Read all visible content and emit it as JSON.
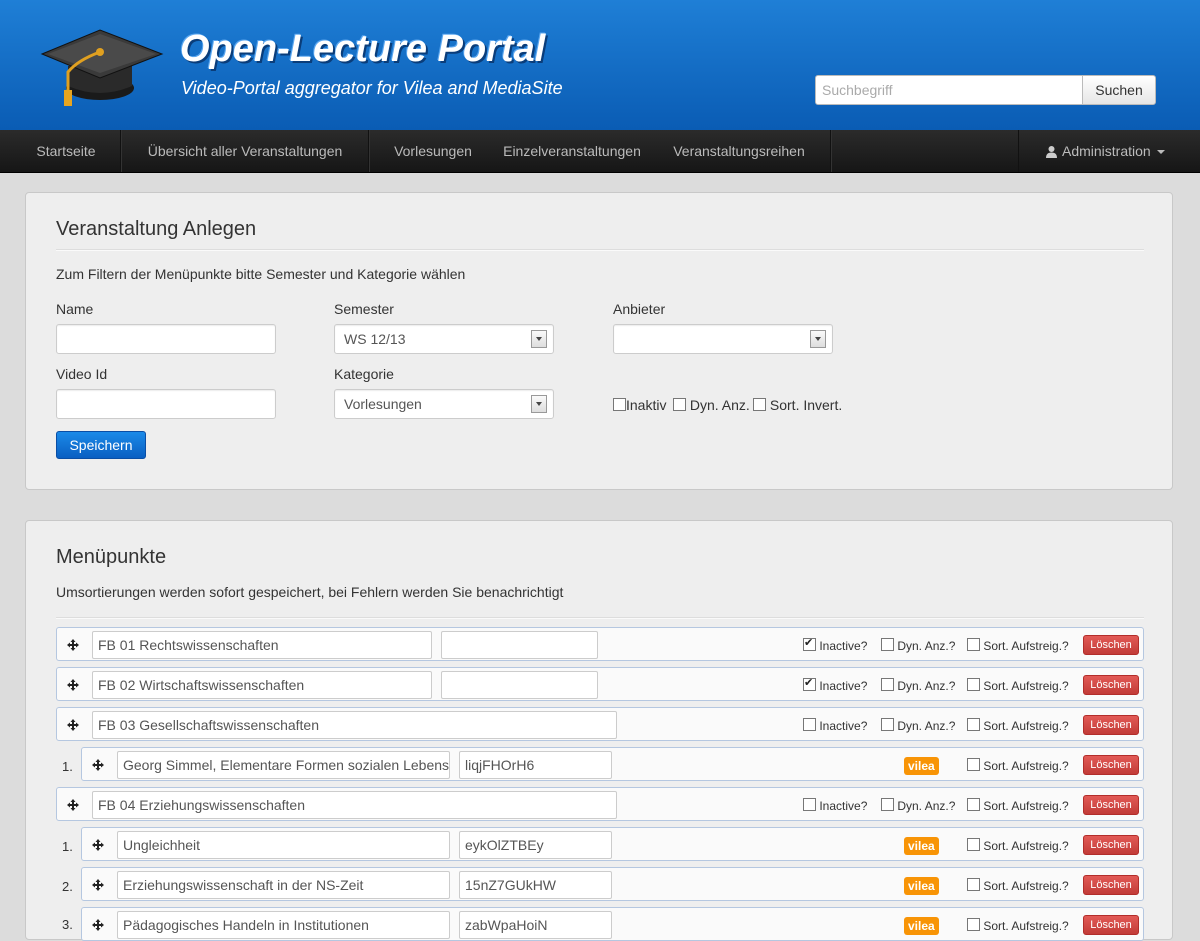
{
  "header": {
    "title": "Open-Lecture Portal",
    "subtitle": "Video-Portal aggregator for Vilea and MediaSite",
    "search_placeholder": "Suchbegriff",
    "search_button": "Suchen"
  },
  "nav": {
    "items": [
      "Startseite",
      "Übersicht aller Veranstaltungen",
      "Vorlesungen",
      "Einzelveranstaltungen",
      "Veranstaltungsreihen"
    ],
    "admin": "Administration"
  },
  "form": {
    "title": "Veranstaltung Anlegen",
    "hint": "Zum Filtern der Menüpunkte bitte Semester und Kategorie wählen",
    "name_label": "Name",
    "name_value": "",
    "semester_label": "Semester",
    "semester_value": "WS 12/13",
    "anbieter_label": "Anbieter",
    "anbieter_value": "",
    "videoid_label": "Video Id",
    "videoid_value": "",
    "kategorie_label": "Kategorie",
    "kategorie_value": "Vorlesungen",
    "inaktiv_label": "Inaktiv",
    "dyn_label": "Dyn. Anz.",
    "sort_label": "Sort. Invert.",
    "save_button": "Speichern"
  },
  "menu": {
    "title": "Menüpunkte",
    "hint": "Umsortierungen werden sofort gespeichert, bei Fehlern werden Sie benachrichtigt",
    "inactive_label": "Inactive?",
    "dyn_label": "Dyn. Anz.?",
    "sort_label": "Sort. Aufstreig.?",
    "delete_label": "Löschen",
    "badge_label": "vilea",
    "rows": [
      {
        "name": "FB 01 Rechtswissenschaften",
        "id": "",
        "inactive": true
      },
      {
        "name": "FB 02 Wirtschaftswissenschaften",
        "id": "",
        "inactive": true
      },
      {
        "name": "FB 03 Gesellschaftswissenschaften",
        "inactive": false
      },
      {
        "num": "1.",
        "name": "Georg Simmel, Elementare Formen sozialen Lebens",
        "id": "liqjFHOrH6"
      },
      {
        "name": "FB 04 Erziehungswissenschaften",
        "inactive": false
      },
      {
        "num": "1.",
        "name": "Ungleichheit",
        "id": "eykOlZTBEy"
      },
      {
        "num": "2.",
        "name": "Erziehungswissenschaft in der NS-Zeit",
        "id": "15nZ7GUkHW"
      },
      {
        "num": "3.",
        "name": "Pädagogisches Handeln in Institutionen",
        "id": "zabWpaHoiN"
      }
    ]
  }
}
